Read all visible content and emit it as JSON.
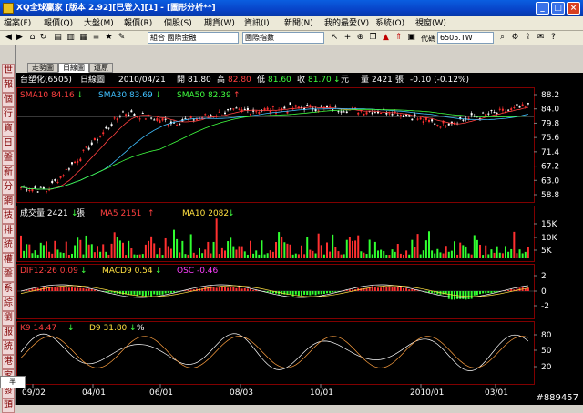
{
  "window": {
    "title": "XQ全球贏家 [版本 2.92][已登入][1] - [圖形分析**]"
  },
  "menu": [
    "檔案(F)",
    "報價(Q)",
    "大盤(M)",
    "報價(R)",
    "個股(S)",
    "期貨(W)",
    "資訊(I)",
    "新聞(N)",
    "我的最愛(V)",
    "系統(O)",
    "視窗(W)"
  ],
  "toolbar": {
    "combo1": "組合 國際金融",
    "combo2": "國際指數",
    "code_label": "代碼",
    "code_value": "6505.TW"
  },
  "left_tabs": [
    "世",
    "報",
    "個",
    "行",
    "資",
    "日",
    "盤",
    "新",
    "分",
    "網",
    "技",
    "排",
    "統",
    "權",
    "盤",
    "系",
    "綜",
    "瀏",
    "服",
    "統",
    "港",
    "家",
    "發",
    "頭"
  ],
  "tabs": [
    "走勢圖",
    "日線圖",
    "還原"
  ],
  "header": {
    "name": "台塑化(6505)",
    "period": "日線圖",
    "date": "2010/04/21",
    "open_label": "開",
    "open": "81.80",
    "high_label": "高",
    "high": "82.80",
    "low_label": "低",
    "low": "81.60",
    "close_label": "收",
    "close": "81.70",
    "unit": "元",
    "vol_label": "量",
    "vol": "2421",
    "vol_unit": "張",
    "change": "-0.10 (-0.12%)"
  },
  "indicators": {
    "sma10": "SMA10 84.16",
    "sma30": "SMA30 83.69",
    "sma50": "SMA50 82.39",
    "vol": "成交量 2421",
    "vol_unit": "張",
    "ma5": "MA5 2151",
    "ma10": "MA10 2082",
    "dif": "DIF12-26 0.09",
    "macd": "MACD9 0.54",
    "osc": "OSC -0.46",
    "k": "K9 14.47",
    "d": "D9 31.80",
    "pct": "%"
  },
  "chart_data": [
    {
      "type": "line",
      "title": "台塑化(6505) 日線圖",
      "y_ticks": [
        58.8,
        63.0,
        67.2,
        71.4,
        75.6,
        79.8,
        84.0,
        88.2
      ],
      "x_ticks": [
        "09/02",
        "04/01",
        "06/01",
        "08/03",
        "10/01",
        "2010/01",
        "03/01"
      ],
      "series": [
        {
          "name": "SMA10",
          "color": "#ff4040"
        },
        {
          "name": "SMA30",
          "color": "#40c0ff"
        },
        {
          "name": "SMA50",
          "color": "#40ff40"
        }
      ]
    },
    {
      "type": "bar",
      "title": "成交量",
      "y_ticks": [
        "15K",
        "10K",
        "5K"
      ]
    },
    {
      "type": "bar",
      "title": "MACD",
      "y_ticks": [
        2,
        0,
        -2
      ]
    },
    {
      "type": "line",
      "title": "KD",
      "y_ticks": [
        80,
        50,
        20
      ]
    }
  ],
  "watermark": "#889457",
  "corner": "半"
}
